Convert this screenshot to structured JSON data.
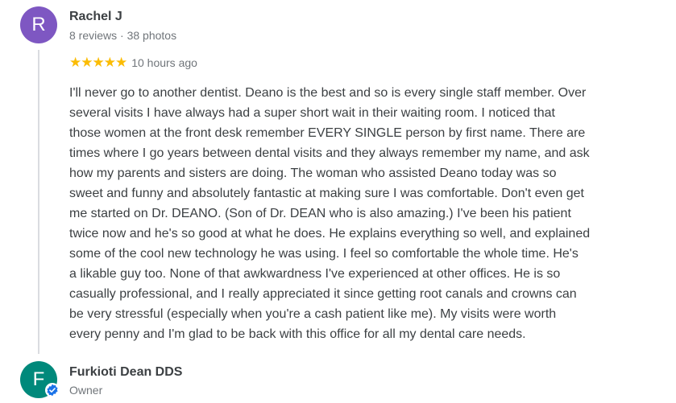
{
  "review": {
    "author": {
      "initial": "R",
      "name": "Rachel J",
      "meta": "8 reviews · 38 photos",
      "avatar_color": "#7e57c2"
    },
    "rating": 5,
    "stars": "★★★★★",
    "time": "10 hours ago",
    "star_color": "#fbbc04",
    "text_lines": [
      "I'll never go to another dentist. Deano is the best and so is every single staff member. Over",
      "several visits I have always had a super short wait in their waiting room. I noticed that",
      "those women at the front desk remember EVERY SINGLE person by first name. There are",
      "times where I go years between dental visits and they always remember my name, and ask",
      "how my parents and sisters are doing. The woman who assisted Deano today was so",
      "sweet and funny and absolutely fantastic at making sure I was comfortable. Don't even get",
      "me started on Dr. DEANO. (Son of Dr. DEAN who is also amazing.) I've been his patient",
      "twice now and he's so good at what he does. He explains everything so well, and explained",
      "some of the cool new technology he was using. I feel so comfortable the whole time. He's",
      "a likable guy too. None of that awkwardness I've experienced at other offices. He is so",
      "casually professional, and I really appreciated it since getting root canals and crowns can",
      "be very stressful (especially when you're a cash patient like me). My visits were worth",
      "every penny and I'm glad to be back with this office for all my dental care needs."
    ]
  },
  "reply": {
    "author": {
      "initial": "F",
      "name": "Furkioti Dean DDS",
      "role": "Owner",
      "avatar_color": "#00897b",
      "badge_icon": "verified-check-icon"
    }
  }
}
